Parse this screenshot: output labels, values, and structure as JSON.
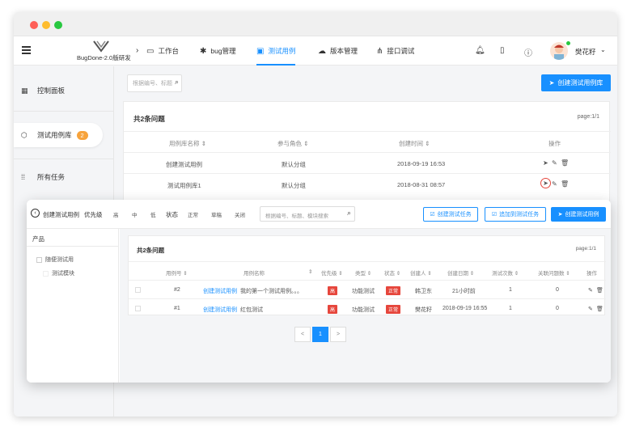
{
  "window": {
    "colors": {
      "accent": "#1890ff",
      "badge": "#f7a33c",
      "danger": "#e6463c"
    }
  },
  "header": {
    "logo_text": "BugDone-2.0版研发",
    "nav": [
      {
        "label": "工作台",
        "icon": "monitor-icon"
      },
      {
        "label": "bug管理",
        "icon": "bug-icon"
      },
      {
        "label": "测试用例",
        "icon": "case-icon",
        "active": true
      },
      {
        "label": "版本管理",
        "icon": "cloud-icon"
      },
      {
        "label": "接口调试",
        "icon": "api-icon"
      }
    ],
    "username": "樊花籽"
  },
  "sidebar": {
    "items": [
      {
        "label": "控制面板",
        "icon": "dashboard-icon"
      },
      {
        "label": "测试用例库",
        "icon": "cube-icon",
        "badge": "2"
      },
      {
        "label": "所有任务",
        "icon": "grid-icon"
      }
    ]
  },
  "main": {
    "search_placeholder": "根据编号、标题",
    "create_button": "创建测试用例库",
    "panel_title": "共2条问题",
    "page_info": "page:1/1",
    "table": {
      "headers": [
        "用例库名称 ⇕",
        "参与角色 ⇕",
        "创建时间 ⇕",
        "操作"
      ],
      "rows": [
        [
          "创建测试用例",
          "默认分组",
          "2018-09-19 16:53"
        ],
        [
          "测试用例库1",
          "默认分组",
          "2018-08-31 08:57"
        ]
      ]
    }
  },
  "overlay": {
    "back_label": "创建测试用例",
    "filters": {
      "priority_label": "优先级",
      "priority_options": [
        "高",
        "中",
        "低"
      ],
      "status_label": "状态",
      "status_options": [
        "正常",
        "草稿",
        "关闭"
      ]
    },
    "search_placeholder": "根据编号、标题、模块搜索",
    "buttons": {
      "create_task": "创建测试任务",
      "add_to_task": "追加到测试任务",
      "create_case": "创建测试用例"
    },
    "tree": {
      "header": "产品",
      "items": [
        "随便测试用",
        "测试模块"
      ]
    },
    "panel_title": "共2条问题",
    "page_info": "page:1/1",
    "table": {
      "headers": [
        "用例号 ⇕",
        "用例名称",
        "⇕",
        "优先级 ⇕",
        "类型 ⇕",
        "状态 ⇕",
        "创建人 ⇕",
        "创建日期 ⇕",
        "测试次数 ⇕",
        "关联问题数 ⇕",
        "操作"
      ],
      "rows": [
        {
          "id": "#2",
          "link": "创建测试用例",
          "name": "我的第一个测试用例。。。",
          "priority": "高",
          "type": "功能测试",
          "status": "正常",
          "creator": "韩卫东",
          "date": "21小时前",
          "runs": "1",
          "issues": "0"
        },
        {
          "id": "#1",
          "link": "创建测试用例",
          "name": "红包测试",
          "priority": "高",
          "type": "功能测试",
          "status": "正常",
          "creator": "樊花籽",
          "date": "2018-09-19 16:55",
          "runs": "1",
          "issues": "0"
        }
      ]
    },
    "pager": {
      "prev": "<",
      "current": "1",
      "next": ">"
    }
  }
}
